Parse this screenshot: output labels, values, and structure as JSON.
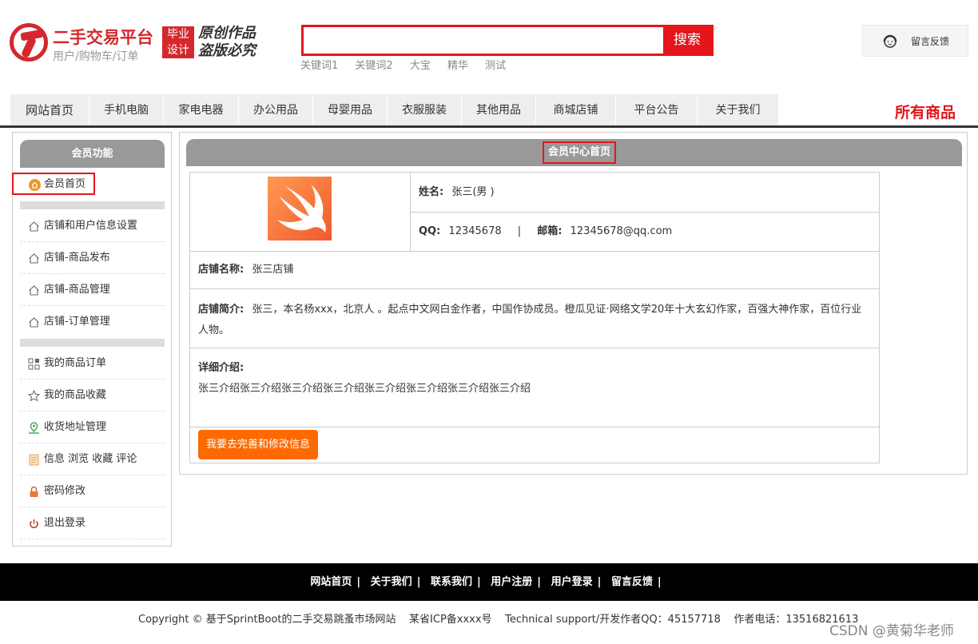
{
  "header": {
    "logo_title": "二手交易平台",
    "logo_sub": "用户/购物车/订单",
    "badge_line1": "毕业",
    "badge_line2": "设计",
    "script_line1": "原创作品",
    "script_line2": "盗版必究",
    "search_button": "搜索",
    "search_value": "",
    "keywords": [
      "关键词1",
      "关键词2",
      "大宝",
      "精华",
      "测试"
    ],
    "feedback_label": "留言反馈",
    "brand_color": "#d4282e",
    "accent_color": "#e4161c"
  },
  "nav": {
    "items": [
      "网站首页",
      "手机电脑",
      "家电电器",
      "办公用品",
      "母婴用品",
      "衣服服装",
      "其他用品",
      "商城店铺",
      "平台公告",
      "关于我们"
    ],
    "all_products": "所有商品"
  },
  "sidebar": {
    "title": "会员功能",
    "home": "会员首页",
    "group1": [
      "店铺和用户信息设置",
      "店铺-商品发布",
      "店铺-商品管理",
      "店铺-订单管理"
    ],
    "group2": [
      "我的商品订单",
      "我的商品收藏",
      "收货地址管理",
      "信息 浏览 收藏 评论",
      "密码修改",
      "退出登录"
    ],
    "icons": [
      "home-icon",
      "grid-icon",
      "star-icon",
      "map-pin-icon",
      "document-icon",
      "lock-icon",
      "power-icon"
    ]
  },
  "main": {
    "title": "会员中心首页",
    "name_label": "姓名:",
    "name_value": "张三(男 )",
    "qq_label": "QQ:",
    "qq_value": "12345678",
    "divider": "|",
    "email_label": "邮箱:",
    "email_value": "12345678@qq.com",
    "shop_label": "店铺名称:",
    "shop_value": "张三店铺",
    "intro_label": "店铺简介:",
    "intro_value": "张三，本名杨xxx，北京人 。起点中文网白金作者，中国作协成员。橙瓜见证·网络文学20年十大玄幻作家，百强大神作家，百位行业人物。",
    "detail_label": "详细介绍:",
    "detail_value": "张三介绍张三介绍张三介绍张三介绍张三介绍张三介绍张三介绍张三介绍",
    "edit_button": "我要去完善和修改信息"
  },
  "footer": {
    "links": [
      "网站首页",
      "关于我们",
      "联系我们",
      "用户注册",
      "用户登录",
      "留言反馈"
    ],
    "separator": "|",
    "copyright": "Copyright © 基于SprintBoot的二手交易跳蚤市场网站    某省ICP备xxxx号    Technical support/开发作者QQ：45157718    作者电话：13516821613",
    "watermark": "CSDN @黄菊华老师"
  }
}
